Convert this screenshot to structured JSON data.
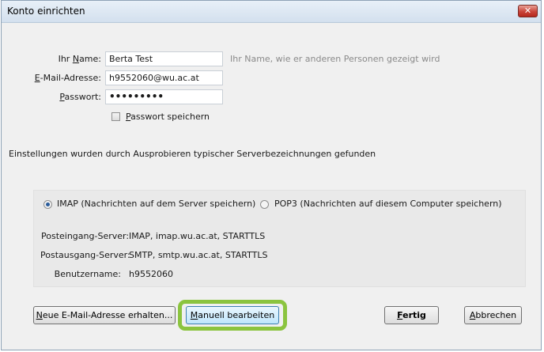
{
  "dialog": {
    "title": "Konto einrichten"
  },
  "form": {
    "name": {
      "label_pre": "Ihr ",
      "label_u": "N",
      "label_post": "ame:",
      "value": "Berta Test",
      "hint": "Ihr Name, wie er anderen Personen gezeigt wird"
    },
    "email": {
      "label_u": "E",
      "label_post": "-Mail-Adresse:",
      "value": "h9552060@wu.ac.at"
    },
    "password": {
      "label_u": "P",
      "label_post": "asswort:",
      "value": "•••••••••"
    },
    "save_password": {
      "label_u": "P",
      "label_post": "asswort speichern",
      "checked": false
    }
  },
  "status_message": "Einstellungen wurden durch Ausprobieren typischer Serverbezeichnungen gefunden",
  "protocol": {
    "selected": "IMAP",
    "imap_label": "IMAP (Nachrichten auf dem Server speichern)",
    "pop3_label": "POP3 (Nachrichten auf diesem Computer speichern)"
  },
  "server_info": {
    "incoming_label": "Posteingang-Server:",
    "incoming_value": "IMAP, imap.wu.ac.at, STARTTLS",
    "outgoing_label": "Postausgang-Server:",
    "outgoing_value": "SMTP, smtp.wu.ac.at, STARTTLS",
    "username_label": "Benutzername:",
    "username_value": "h9552060"
  },
  "buttons": {
    "new_address": {
      "label_u": "N",
      "label_post": "eue E-Mail-Adresse erhalten..."
    },
    "manual": {
      "label_u": "M",
      "label_post": "anuell bearbeiten"
    },
    "done": {
      "label_u": "F",
      "label_post": "ertig"
    },
    "cancel": {
      "label_u": "A",
      "label_post": "bbrechen"
    }
  },
  "colors": {
    "highlight": "#8bc43f",
    "title_gradient": "#d3e0ee",
    "close_button": "#c9443a"
  }
}
